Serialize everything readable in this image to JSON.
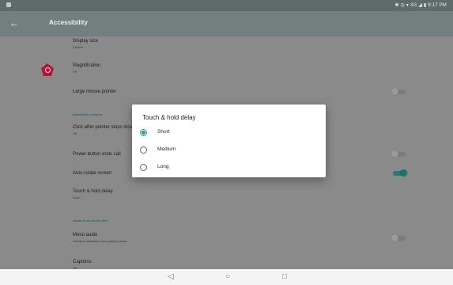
{
  "status_bar": {
    "right_text": "✱ ◷ ▾ 3G ◢ ▮ 9:17 PM"
  },
  "app_bar": {
    "title": "Accessibility"
  },
  "settings": {
    "display_size": {
      "title": "Display size",
      "subtitle": "Default"
    },
    "magnification": {
      "title": "Magnification",
      "subtitle": "Off"
    },
    "large_mouse_pointer": {
      "title": "Large mouse pointer",
      "toggle_on": false
    },
    "section_interaction": "Interaction controls",
    "click_after_pointer": {
      "title": "Click after pointer stops moving",
      "subtitle": "Off"
    },
    "power_button": {
      "title": "Power button ends call",
      "toggle_on": false
    },
    "auto_rotate": {
      "title": "Auto-rotate screen",
      "toggle_on": true
    },
    "touch_hold": {
      "title": "Touch & hold delay",
      "subtitle": "Short"
    },
    "section_audio": "Audio & on-screen text",
    "mono_audio": {
      "title": "Mono audio",
      "subtitle": "Combine channels when playing audio",
      "toggle_on": false
    },
    "captions": {
      "title": "Captions",
      "subtitle": "Off"
    }
  },
  "dialog": {
    "title": "Touch & hold delay",
    "options": [
      {
        "label": "Short",
        "selected": true
      },
      {
        "label": "Medium",
        "selected": false
      },
      {
        "label": "Long",
        "selected": false
      }
    ]
  },
  "nav_bar": {
    "back": "◁",
    "home": "○",
    "recents": "□"
  },
  "colors": {
    "accent": "#31a08f",
    "app_bar": "#71807f",
    "magnification_icon": "#b3153b"
  }
}
